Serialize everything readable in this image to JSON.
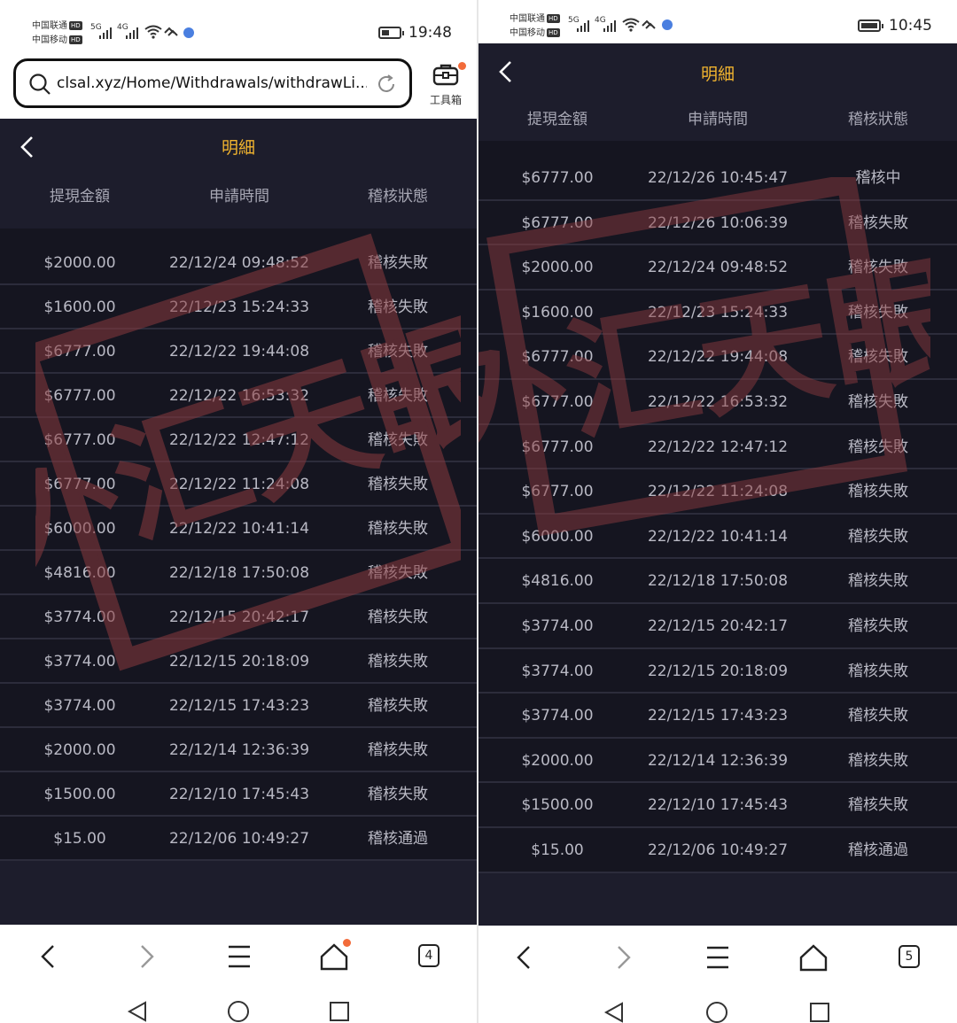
{
  "screens": [
    {
      "status": {
        "carrier1": "中国联通",
        "carrier2": "中国移动",
        "hd": "HD",
        "net1": "5G",
        "net2": "4G",
        "time": "19:48"
      },
      "browser": {
        "url": "clsal.xyz/Home/Withdrawals/withdrawLi...",
        "toolbox_label": "工具箱"
      },
      "header": {
        "title": "明細"
      },
      "columns": [
        "提現金額",
        "申請時間",
        "稽核狀態"
      ],
      "rows": [
        [
          "$2000.00",
          "22/12/24 09:48:52",
          "稽核失敗"
        ],
        [
          "$1600.00",
          "22/12/23 15:24:33",
          "稽核失敗"
        ],
        [
          "$6777.00",
          "22/12/22 19:44:08",
          "稽核失敗"
        ],
        [
          "$6777.00",
          "22/12/22 16:53:32",
          "稽核失敗"
        ],
        [
          "$6777.00",
          "22/12/22 12:47:12",
          "稽核失敗"
        ],
        [
          "$6777.00",
          "22/12/22 11:24:08",
          "稽核失敗"
        ],
        [
          "$6000.00",
          "22/12/22 10:41:14",
          "稽核失敗"
        ],
        [
          "$4816.00",
          "22/12/18 17:50:08",
          "稽核失敗"
        ],
        [
          "$3774.00",
          "22/12/15 20:42:17",
          "稽核失敗"
        ],
        [
          "$3774.00",
          "22/12/15 20:18:09",
          "稽核失敗"
        ],
        [
          "$3774.00",
          "22/12/15 17:43:23",
          "稽核失敗"
        ],
        [
          "$2000.00",
          "22/12/14 12:36:39",
          "稽核失敗"
        ],
        [
          "$1500.00",
          "22/12/10 17:45:43",
          "稽核失敗"
        ],
        [
          "$15.00",
          "22/12/06 10:49:27",
          "稽核通過"
        ]
      ],
      "nav": {
        "tabs_count": "4"
      }
    },
    {
      "status": {
        "carrier1": "中国联通",
        "carrier2": "中国移动",
        "hd": "HD",
        "net1": "5G",
        "net2": "4G",
        "time": "10:45"
      },
      "header": {
        "title": "明細"
      },
      "columns": [
        "提現金額",
        "申請時間",
        "稽核狀態"
      ],
      "rows": [
        [
          "$6777.00",
          "22/12/26 10:45:47",
          "稽核中"
        ],
        [
          "$6777.00",
          "22/12/26 10:06:39",
          "稽核失敗"
        ],
        [
          "$2000.00",
          "22/12/24 09:48:52",
          "稽核失敗"
        ],
        [
          "$1600.00",
          "22/12/23 15:24:33",
          "稽核失敗"
        ],
        [
          "$6777.00",
          "22/12/22 19:44:08",
          "稽核失敗"
        ],
        [
          "$6777.00",
          "22/12/22 16:53:32",
          "稽核失敗"
        ],
        [
          "$6777.00",
          "22/12/22 12:47:12",
          "稽核失敗"
        ],
        [
          "$6777.00",
          "22/12/22 11:24:08",
          "稽核失敗"
        ],
        [
          "$6000.00",
          "22/12/22 10:41:14",
          "稽核失敗"
        ],
        [
          "$4816.00",
          "22/12/18 17:50:08",
          "稽核失敗"
        ],
        [
          "$3774.00",
          "22/12/15 20:42:17",
          "稽核失敗"
        ],
        [
          "$3774.00",
          "22/12/15 20:18:09",
          "稽核失敗"
        ],
        [
          "$3774.00",
          "22/12/15 17:43:23",
          "稽核失敗"
        ],
        [
          "$2000.00",
          "22/12/14 12:36:39",
          "稽核失敗"
        ],
        [
          "$1500.00",
          "22/12/10 17:45:43",
          "稽核失敗"
        ],
        [
          "$15.00",
          "22/12/06 10:49:27",
          "稽核通過"
        ]
      ],
      "nav": {
        "tabs_count": "5"
      }
    }
  ],
  "watermark": {
    "text": "外汇天眼"
  },
  "colors": {
    "accent": "#f1b42f",
    "app_bg": "#1d1d2c",
    "row_bg": "#151520",
    "watermark": "#8a3a3e"
  }
}
